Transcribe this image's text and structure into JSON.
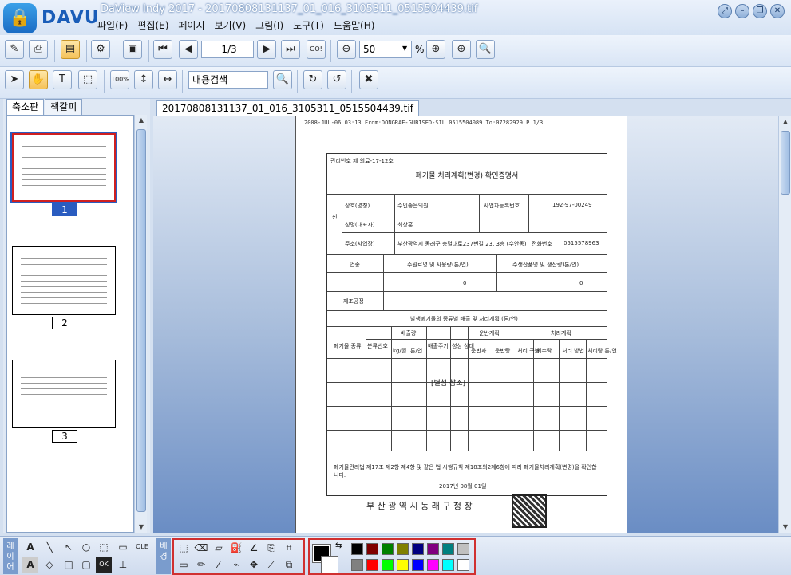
{
  "app": {
    "logo_text": "DAVU",
    "window_title": "DaView Indy 2017 - 20170808131137_01_016_3105311_0515504439.tif",
    "menu": [
      "파일(F)",
      "편집(E)",
      "페이지",
      "보기(V)",
      "그림(I)",
      "도구(T)",
      "도움말(H)"
    ]
  },
  "toolbar": {
    "page_indicator": "1/3",
    "zoom_value": "50",
    "zoom_unit": "%",
    "search_placeholder": "내용검색",
    "goto_label": "GO!"
  },
  "left_panel": {
    "tabs": [
      "축소판",
      "책갈피"
    ],
    "thumbnails": [
      {
        "label": "1",
        "selected": true
      },
      {
        "label": "2",
        "selected": false
      },
      {
        "label": "3",
        "selected": false
      }
    ]
  },
  "document": {
    "tab_title": "20170808131137_01_016_3105311_0515504439.tif",
    "fax_header": "2008-JUL-06 03:13 From:DONGRAE-GUBISED-SIL  0515504089        To:07282929      P.1/3",
    "form_number": "관리번호 제 의료-17-12호",
    "form_title": "폐기물 처리계획(변경) 확인증명서",
    "fields": {
      "applicant": "신",
      "name_label": "상호(명칭)",
      "name_value": "수인좋은의원",
      "bizno_label": "사업자등록번호",
      "bizno_value": "192-97-00249",
      "rep_label": "성명(대표자)",
      "rep_value": "최상훈",
      "addr_label": "주소(사업장)",
      "addr_value": "부산광역시 동래구 충렬대로237번길 23, 3층 (수안동)",
      "phone_label": "전화번호",
      "phone_value": "0515578963",
      "industry": "업종",
      "raw_label": "주원료명 및 사용량(톤/연)",
      "product_label": "주생산품명 및 생산량(톤/연)",
      "raw_value": "0",
      "product_value": "0",
      "process_label": "제조공정",
      "waste_section": "발생폐기물의 종류별 배출 및 처리계획 (톤/연)",
      "col_kind": "폐기물 종류",
      "col_code": "분류번호",
      "col_amount": "배출량",
      "col_kg": "kg/월",
      "col_ton": "톤/연",
      "col_cycle": "배출주기",
      "col_state": "성상 상태",
      "col_transport": "운반계획",
      "col_carrier": "운반자",
      "col_method": "운반량",
      "col_treat": "처리계획",
      "col_treat_div": "처리 구분",
      "col_treater": "위수탁",
      "col_treat_method": "처리 방법",
      "col_treat_amount": "처리량 톤/연",
      "attached": "[별첨 참조]",
      "footer_text": "폐기물관리법 제17조 제2항·제4항 및 같은 법 시행규칙 제18조의2제6항에 따라 폐기물처리계획(변경)을 확인합니다.",
      "date": "2017년 08월 01일",
      "issuer": "부 산 광 역 시    동 래 구 청 장"
    }
  },
  "palette": {
    "draw_tab": "레이어",
    "bg_tab": "배경",
    "colors_top": [
      "#000000",
      "#800000",
      "#008000",
      "#808000",
      "#000080",
      "#800080",
      "#008080",
      "#c0c0c0"
    ],
    "colors_bottom": [
      "#808080",
      "#ff0000",
      "#00ff00",
      "#ffff00",
      "#0000ff",
      "#ff00ff",
      "#00ffff",
      "#ffffff"
    ]
  }
}
